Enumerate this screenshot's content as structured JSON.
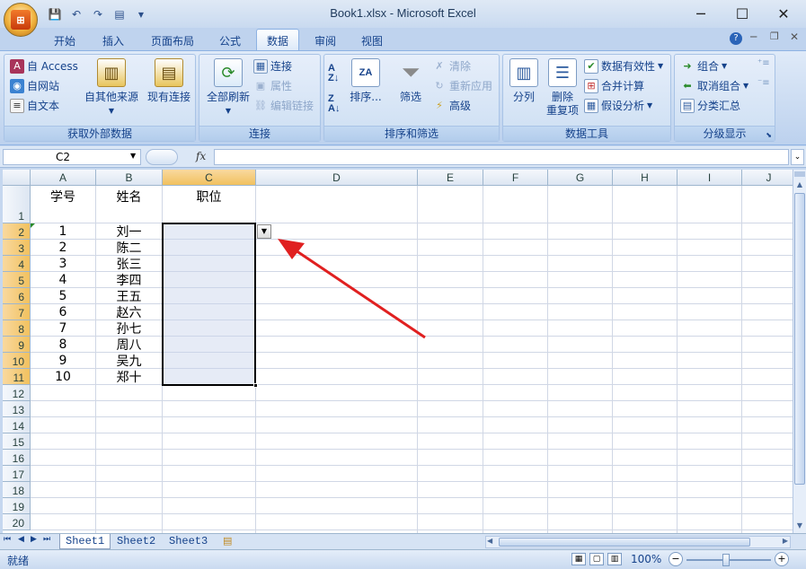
{
  "window": {
    "title": "Book1.xlsx - Microsoft Excel",
    "minimize": "─",
    "maximize": "☐",
    "close": "✕"
  },
  "quick_access": {
    "save_icon": "save-icon",
    "undo_icon": "undo-icon",
    "redo_icon": "redo-icon",
    "customize": "▼"
  },
  "tabs": [
    "开始",
    "插入",
    "页面布局",
    "公式",
    "数据",
    "审阅",
    "视图"
  ],
  "active_tab": "数据",
  "ribbon": {
    "get_external": {
      "label": "获取外部数据",
      "access": "自 Access",
      "web": "自网站",
      "text": "自文本",
      "other": "自其他来源",
      "existing": "现有连接"
    },
    "connections": {
      "label": "连接",
      "refresh_all": "全部刷新",
      "connections": "连接",
      "properties": "属性",
      "edit_links": "编辑链接"
    },
    "sort_filter": {
      "label": "排序和筛选",
      "sort": "排序...",
      "filter": "筛选",
      "clear": "清除",
      "reapply": "重新应用",
      "advanced": "高级"
    },
    "data_tools": {
      "label": "数据工具",
      "split": "分列",
      "remove_dup_1": "删除",
      "remove_dup_2": "重复项",
      "validation": "数据有效性",
      "consolidate": "合并计算",
      "whatif": "假设分析"
    },
    "outline": {
      "label": "分级显示",
      "group": "组合",
      "ungroup": "取消组合",
      "subtotal": "分类汇总"
    }
  },
  "formula_bar": {
    "name_box": "C2",
    "fx": "fx",
    "value": ""
  },
  "columns": [
    "A",
    "B",
    "C",
    "D",
    "E",
    "F",
    "G",
    "H",
    "I",
    "J"
  ],
  "rows": [
    "1",
    "2",
    "3",
    "4",
    "5",
    "6",
    "7",
    "8",
    "9",
    "10",
    "11",
    "12",
    "13",
    "14",
    "15",
    "16",
    "17",
    "18",
    "19",
    "20"
  ],
  "headers": {
    "a1": "学号",
    "b1": "姓名",
    "c1": "职位"
  },
  "data_rows": [
    {
      "id": "1",
      "name": "刘一"
    },
    {
      "id": "2",
      "name": "陈二"
    },
    {
      "id": "3",
      "name": "张三"
    },
    {
      "id": "4",
      "name": "李四"
    },
    {
      "id": "5",
      "name": "王五"
    },
    {
      "id": "6",
      "name": "赵六"
    },
    {
      "id": "7",
      "name": "孙七"
    },
    {
      "id": "8",
      "name": "周八"
    },
    {
      "id": "9",
      "name": "吴九"
    },
    {
      "id": "10",
      "name": "郑十"
    }
  ],
  "sheets": [
    "Sheet1",
    "Sheet2",
    "Sheet3"
  ],
  "active_sheet": "Sheet1",
  "status": {
    "ready": "就绪",
    "zoom": "100%"
  },
  "colors": {
    "arrow": "#e02020",
    "selection_border": "#000000",
    "header_selected": "#f1c15f"
  }
}
